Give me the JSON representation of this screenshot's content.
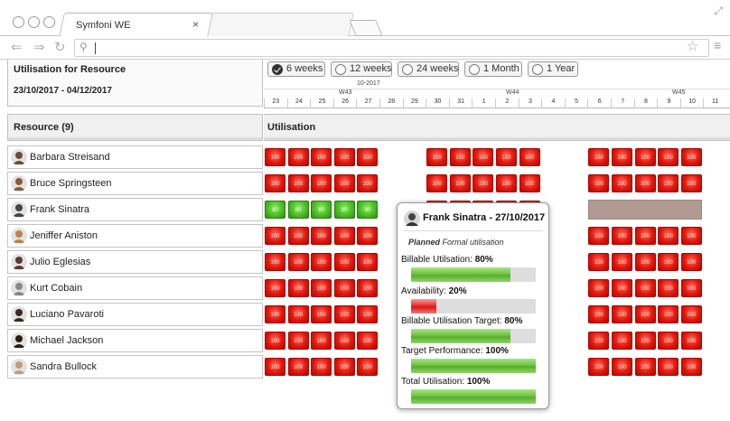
{
  "browser": {
    "tab_title": "Symfoni WE",
    "tab_close": "×",
    "back_icon": "back-arrow-icon",
    "forward_icon": "forward-arrow-icon",
    "reload_icon": "reload-icon",
    "search_icon": "search-icon",
    "bookmark_icon": "star-icon",
    "menu_icon": "hamburger-menu-icon"
  },
  "sidebar": {
    "title": "Utilisation for Resource",
    "date_range": "23/10/2017 - 04/12/2017",
    "resource_header": "Resource (9)"
  },
  "range_buttons": [
    {
      "label": "6 weeks",
      "selected": true
    },
    {
      "label": "12 weeks",
      "selected": false
    },
    {
      "label": "24 weeks",
      "selected": false
    },
    {
      "label": "1 Month",
      "selected": false
    },
    {
      "label": "1 Year",
      "selected": false
    }
  ],
  "timeline": {
    "month": "10-2017",
    "weeks": [
      "W43",
      "W44",
      "W45"
    ],
    "days": [
      "23",
      "24",
      "25",
      "26",
      "27",
      "28",
      "29",
      "30",
      "31",
      "1",
      "2",
      "3",
      "4",
      "5",
      "6",
      "7",
      "8",
      "9",
      "10",
      "11"
    ]
  },
  "utilisation_header": "Utilisation",
  "resources": [
    {
      "name": "Barbara Streisand",
      "status": "red",
      "value": "100",
      "avatar_color": "#6d4a3a"
    },
    {
      "name": "Bruce Springsteen",
      "status": "red",
      "value": "100",
      "avatar_color": "#8a5a3a"
    },
    {
      "name": "Frank Sinatra",
      "status": "green",
      "value": "80",
      "avatar_color": "#444444"
    },
    {
      "name": "Jeniffer Aniston",
      "status": "red",
      "value": "100",
      "avatar_color": "#b7864e"
    },
    {
      "name": "Julio Eglesias",
      "status": "red",
      "value": "100",
      "avatar_color": "#5a3a2e"
    },
    {
      "name": "Kurt Cobain",
      "status": "red",
      "value": "100",
      "avatar_color": "#888888"
    },
    {
      "name": "Luciano Pavaroti",
      "status": "red",
      "value": "100",
      "avatar_color": "#3a2a20"
    },
    {
      "name": "Michael Jackson",
      "status": "red",
      "value": "100",
      "avatar_color": "#2c1c14"
    },
    {
      "name": "Sandra Bullock",
      "status": "red",
      "value": "100",
      "avatar_color": "#c49a7a"
    }
  ],
  "tooltip": {
    "title": "Frank Sinatra - 27/10/2017",
    "planned_bold": "Planned",
    "planned_rest": " Formal utilisation",
    "metrics": [
      {
        "label": "Billable Utilsation: 80%",
        "fraction": 0.8,
        "color": "green"
      },
      {
        "label": "Availability: 20%",
        "fraction": 0.2,
        "color": "red"
      },
      {
        "label": "Billable Utilisation Target: 80%",
        "fraction": 0.8,
        "color": "green"
      },
      {
        "label": "Target Performance: 100%",
        "fraction": 1.0,
        "color": "green"
      },
      {
        "label": "Total Utilisation: 100%",
        "fraction": 1.0,
        "color": "green"
      }
    ]
  },
  "colors": {
    "over_utilised": "#e0180c",
    "on_target": "#4bbf22",
    "leave_block": "#b09a92"
  }
}
